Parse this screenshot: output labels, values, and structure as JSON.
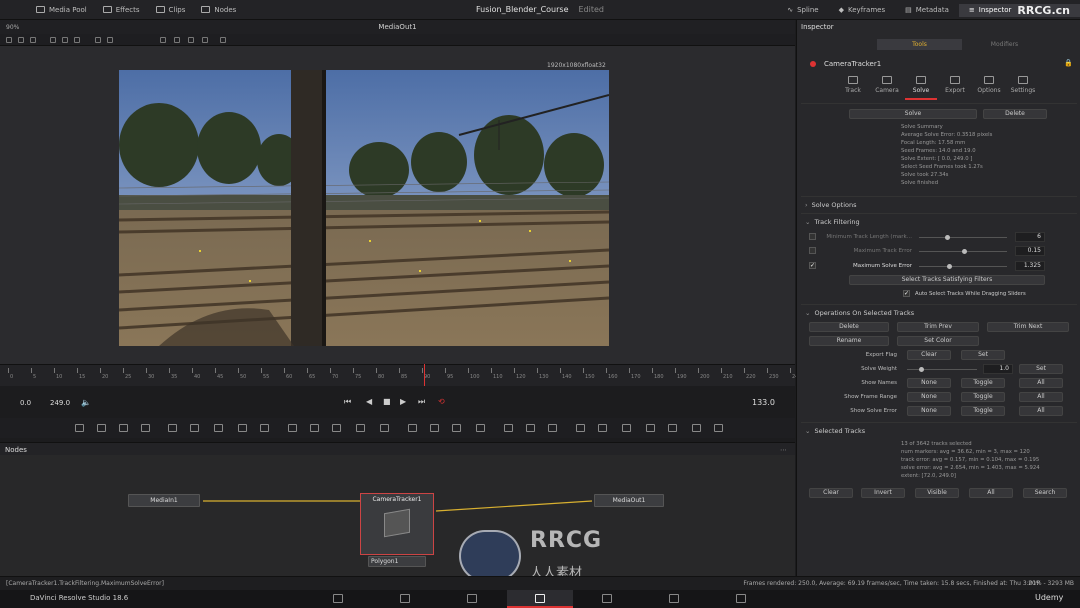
{
  "topbar": {
    "media_pool": "Media Pool",
    "effects": "Effects",
    "clips": "Clips",
    "nodes": "Nodes",
    "project": "Fusion_Blender_Course",
    "status": "Edited",
    "spline": "Spline",
    "keyframes": "Keyframes",
    "metadata": "Metadata",
    "inspector": "Inspector"
  },
  "viewer": {
    "zoom": "90%",
    "title": "MediaOut1",
    "resolution": "1920x1080xfloat32"
  },
  "timeline": {
    "start": "0.0",
    "end": "249.0",
    "current": "133.0",
    "ticks": [
      "0",
      "5",
      "10",
      "15",
      "20",
      "25",
      "30",
      "35",
      "40",
      "45",
      "50",
      "55",
      "60",
      "65",
      "70",
      "75",
      "80",
      "85",
      "90",
      "95",
      "100",
      "110",
      "120",
      "130",
      "140",
      "150",
      "160",
      "170",
      "180",
      "190",
      "200",
      "210",
      "220",
      "230",
      "240"
    ]
  },
  "nodes_panel": {
    "title": "Nodes",
    "media_in": "MediaIn1",
    "camera_tracker": "CameraTracker1",
    "media_out": "MediaOut1",
    "polygon": "Polygon1"
  },
  "inspector": {
    "title": "Inspector",
    "tab_tools": "Tools",
    "tab_modifiers": "Modifiers",
    "tool_name": "CameraTracker1",
    "subtabs": [
      "Track",
      "Camera",
      "Solve",
      "Export",
      "Options",
      "Settings"
    ],
    "solve_button": "Solve",
    "delete_button": "Delete",
    "solve_summary": [
      "Solve Summary",
      "Average Solve Error: 0.3518 pixels",
      "Focal Length: 17.58 mm",
      "Seed Frames: 14.0 and 19.0",
      "Solve Extent: [ 0.0, 249.0 ]",
      "Select Seed Frames took 1.27s",
      "Solve took 27.34s",
      "Solve finished"
    ],
    "solve_options": "Solve Options",
    "track_filtering": "Track Filtering",
    "min_track_length_label": "Minimum Track Length (mark...",
    "min_track_length_value": "6",
    "max_track_error_label": "Maximum Track Error",
    "max_track_error_value": "0.15",
    "max_solve_error_label": "Maximum Solve Error",
    "max_solve_error_value": "1.325",
    "select_tracks_button": "Select Tracks Satisfying Filters",
    "auto_select_label": "Auto Select Tracks While Dragging Sliders",
    "ops_title": "Operations On Selected Tracks",
    "ops_delete": "Delete",
    "ops_trim_prev": "Trim Prev",
    "ops_trim_next": "Trim Next",
    "ops_rename": "Rename",
    "ops_set_color": "Set Color",
    "export_flag": "Export Flag",
    "clear": "Clear",
    "set": "Set",
    "solve_weight": "Solve Weight",
    "solve_weight_value": "1.0",
    "show_names": "Show Names",
    "show_frame_range": "Show Frame Range",
    "show_solve_error": "Show Solve Error",
    "none": "None",
    "toggle": "Toggle",
    "all": "All",
    "selected_tracks_title": "Selected Tracks",
    "selected_info": [
      "13 of 3642 tracks selected",
      "num markers:  avg = 36.62, min = 3, max = 120",
      "track error:  avg = 0.157, min = 0.104, max = 0.195",
      "solve error:  avg = 2.654, min = 1.403, max = 5.924",
      "extent:  [72.0, 249.0]"
    ],
    "sel_clear": "Clear",
    "sel_invert": "Invert",
    "sel_visible": "Visible",
    "sel_all": "All",
    "sel_search": "Search"
  },
  "status": {
    "left": "[CameraTracker1.TrackFiltering.MaximumSolveError]",
    "right": "Frames rendered: 250.0,  Average: 69.19 frames/sec,  Time taken: 15.8 secs,  Finished at: Thu 3:01P",
    "mem": "20% - 3293 MB"
  },
  "pagebar": {
    "app": "DaVinci Resolve Studio 18.6"
  },
  "watermark": {
    "brand": "RRCG",
    "sub": "人人素材",
    "corner": "RRCG.cn",
    "udemy": "Udemy"
  },
  "colors": {
    "accent_red": "#d33333",
    "accent_yellow": "#e0b030",
    "panel_bg": "#28282b"
  }
}
